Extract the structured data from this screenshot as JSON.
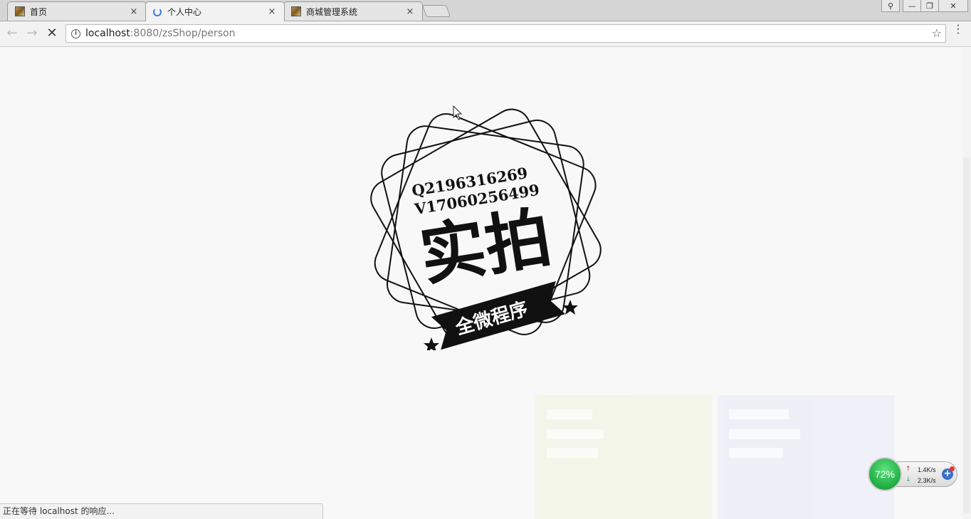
{
  "tabs": [
    {
      "title": "首页",
      "close": "×"
    },
    {
      "title": "个人中心",
      "close": "×"
    },
    {
      "title": "商城管理系统",
      "close": "×"
    }
  ],
  "window_controls": {
    "user": "⚲",
    "minimize": "—",
    "restore": "❐",
    "close": "✕"
  },
  "toolbar": {
    "back": "←",
    "forward": "→",
    "stop": "✕",
    "url_host": "localhost",
    "url_rest": ":8080/zsShop/person",
    "star": "☆",
    "menu": "⋮"
  },
  "stamp": {
    "line1": "Q2196316269",
    "line2": "V17060256499",
    "main_text": "实拍",
    "ribbon_text": "全微程序"
  },
  "status_text": "正在等待 localhost 的响应...",
  "net_widget": {
    "percent": "72%",
    "upload": "1.4K/s",
    "download": "2.3K/s",
    "plus": "+"
  }
}
